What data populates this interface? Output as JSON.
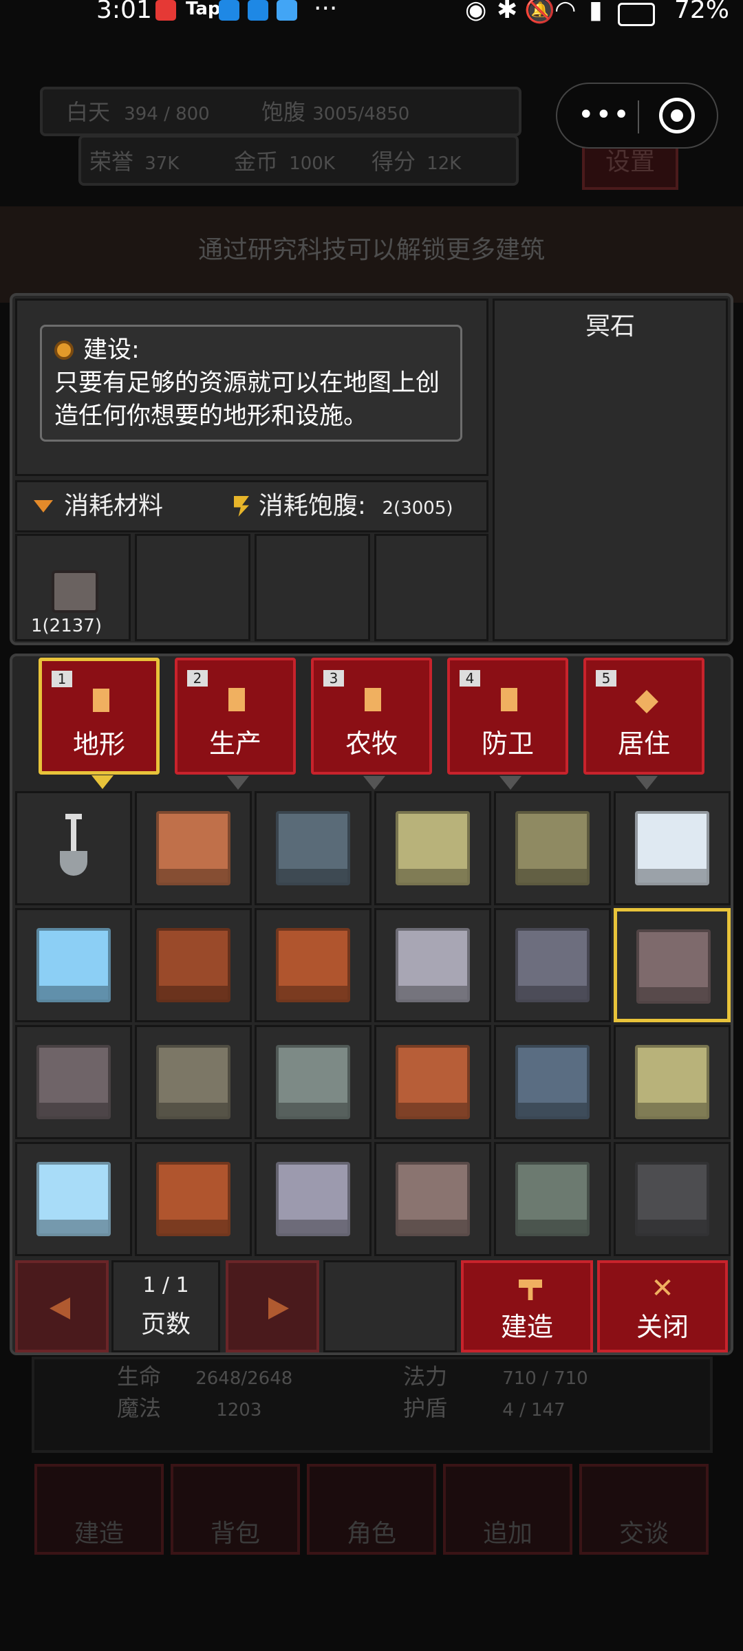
{
  "status_bar": {
    "time": "3:01",
    "battery": "72%",
    "app_badge": "Tap"
  },
  "hud": {
    "day_label": "白天",
    "day_value": "394 / 800",
    "hunger_label": "饱腹",
    "hunger_value": "3005/4850",
    "honor_label": "荣誉",
    "honor_value": "37K",
    "gold_label": "金币",
    "gold_value": "100K",
    "score_label": "得分",
    "score_value": "12K",
    "settings_label": "设置",
    "hint": "通过研究科技可以解锁更多建筑"
  },
  "dialog": {
    "title_label": "建设:",
    "description": "只要有足够的资源就可以在地图上创造任何你想要的地形和设施。",
    "selected_name": "冥石",
    "cost_materials_label": "消耗材料",
    "cost_hunger_label": "消耗饱腹:",
    "cost_hunger_value": "2(3005)",
    "material_slots": [
      {
        "count": "1(2137)"
      },
      {
        "count": ""
      },
      {
        "count": ""
      },
      {
        "count": ""
      }
    ]
  },
  "tabs": [
    {
      "num": "1",
      "label": "地形",
      "active": true
    },
    {
      "num": "2",
      "label": "生产",
      "active": false
    },
    {
      "num": "3",
      "label": "农牧",
      "active": false
    },
    {
      "num": "4",
      "label": "防卫",
      "active": false
    },
    {
      "num": "5",
      "label": "居住",
      "active": false
    }
  ],
  "tiles": [
    [
      "shovel-icon",
      "#c0704a",
      "#5a6b78",
      "#b8b27a",
      "#8f8a62",
      "#dfe9f2"
    ],
    [
      "#8ccff5",
      "#9a4a2a",
      "#b0552e",
      "#a8a6b4",
      "#6d6e7e",
      "#7e6a6c"
    ],
    [
      "#6f6468",
      "#7c7766",
      "#7d8a86",
      "#b75e38",
      "#5a6d82",
      "#b8b27a"
    ],
    [
      "#a8dcf8",
      "#b0552e",
      "#9c9aae",
      "#8a7470",
      "#6c7a70",
      "#4d4d50"
    ]
  ],
  "selected_tile": [
    1,
    5
  ],
  "footer": {
    "page": "1 / 1",
    "page_label": "页数",
    "build_label": "建造",
    "close_label": "关闭"
  },
  "stats": {
    "hp_label": "生命",
    "hp_value": "2648/2648",
    "mana_label": "法力",
    "mana_value": "710 / 710",
    "magic_label": "魔法",
    "magic_value": "1203",
    "shield_label": "护盾",
    "shield_value": "4 / 147"
  },
  "bottom_nav": [
    "建造",
    "背包",
    "角色",
    "追加",
    "交谈"
  ],
  "colors": {
    "accent_red": "#8b0f15",
    "border_red": "#c8232c",
    "gold": "#e8c33a"
  }
}
